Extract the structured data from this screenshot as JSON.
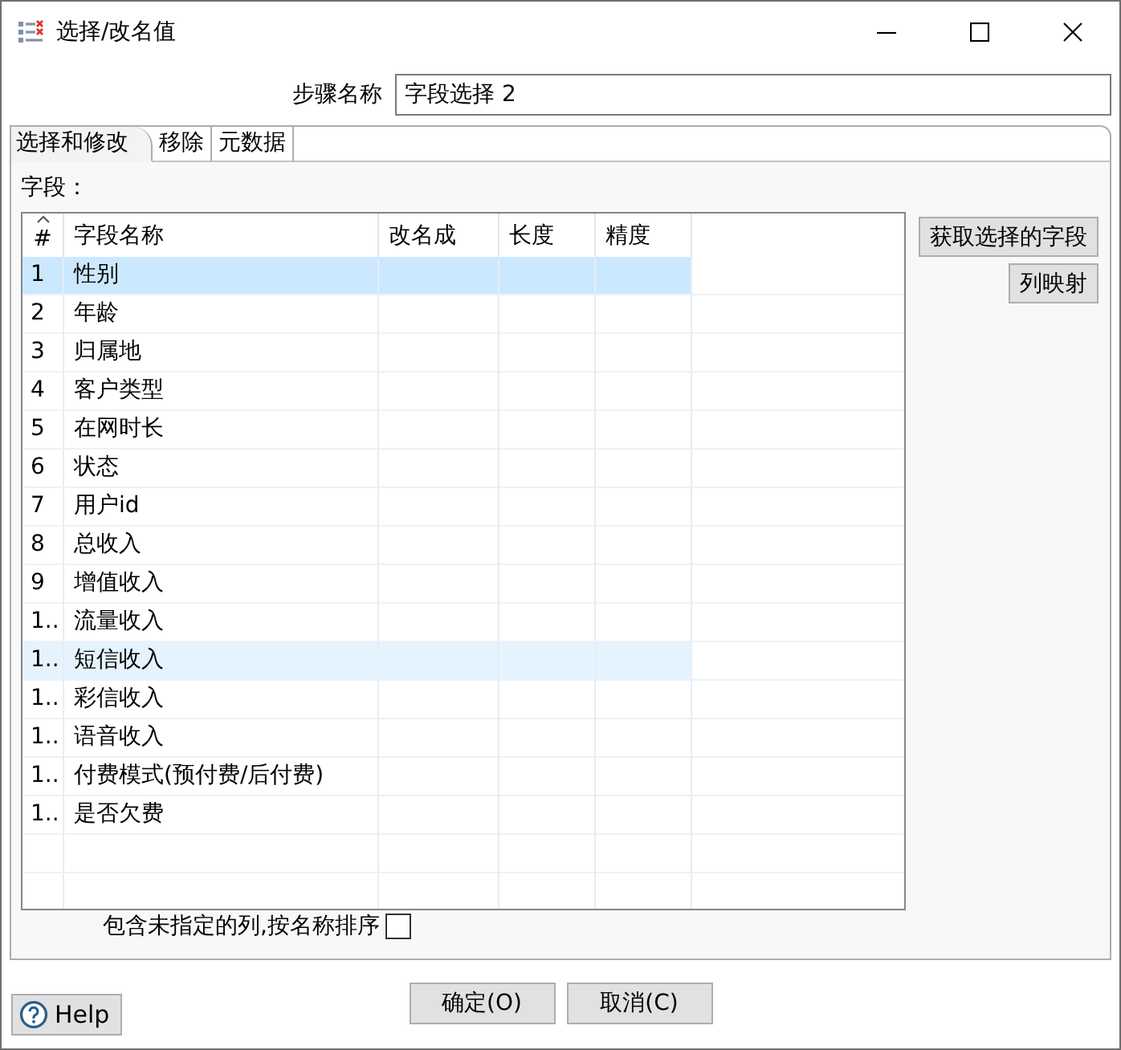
{
  "window": {
    "title": "选择/改名值"
  },
  "step_name": {
    "label": "步骤名称",
    "value": "字段选择 2"
  },
  "tabs": [
    {
      "label": "选择和修改",
      "selected": true
    },
    {
      "label": "移除",
      "selected": false
    },
    {
      "label": "元数据",
      "selected": false
    }
  ],
  "fields_panel": {
    "label": "字段：",
    "table": {
      "columns": [
        {
          "label": "#",
          "sorted": true
        },
        {
          "label": "字段名称",
          "sorted": false
        },
        {
          "label": "改名成",
          "sorted": false
        },
        {
          "label": "长度",
          "sorted": false
        },
        {
          "label": "精度",
          "sorted": false
        }
      ],
      "rows": [
        {
          "number": "1",
          "field_name": "性别",
          "selected": true,
          "highlighted": false
        },
        {
          "number": "2",
          "field_name": "年龄",
          "selected": false,
          "highlighted": false
        },
        {
          "number": "3",
          "field_name": "归属地",
          "selected": false,
          "highlighted": false
        },
        {
          "number": "4",
          "field_name": "客户类型",
          "selected": false,
          "highlighted": false
        },
        {
          "number": "5",
          "field_name": "在网时长",
          "selected": false,
          "highlighted": false
        },
        {
          "number": "6",
          "field_name": "状态",
          "selected": false,
          "highlighted": false
        },
        {
          "number": "7",
          "field_name": "用户id",
          "selected": false,
          "highlighted": false
        },
        {
          "number": "8",
          "field_name": "总收入",
          "selected": false,
          "highlighted": false
        },
        {
          "number": "9",
          "field_name": "增值收入",
          "selected": false,
          "highlighted": false
        },
        {
          "number": "1..",
          "field_name": "流量收入",
          "selected": false,
          "highlighted": false
        },
        {
          "number": "1..",
          "field_name": "短信收入",
          "selected": false,
          "highlighted": true
        },
        {
          "number": "1..",
          "field_name": "彩信收入",
          "selected": false,
          "highlighted": false
        },
        {
          "number": "1..",
          "field_name": "语音收入",
          "selected": false,
          "highlighted": false
        },
        {
          "number": "1..",
          "field_name": "付费模式(预付费/后付费)",
          "selected": false,
          "highlighted": false
        },
        {
          "number": "1..",
          "field_name": "是否欠费",
          "selected": false,
          "highlighted": false
        }
      ]
    },
    "buttons": [
      "获取选择的字段",
      "列映射"
    ],
    "include_unspecified": {
      "label": "包含未指定的列,按名称排序",
      "checked": false
    }
  },
  "help_button": {
    "label": "Help"
  },
  "dialog_buttons": [
    "确定(O)",
    "取消(C)"
  ]
}
